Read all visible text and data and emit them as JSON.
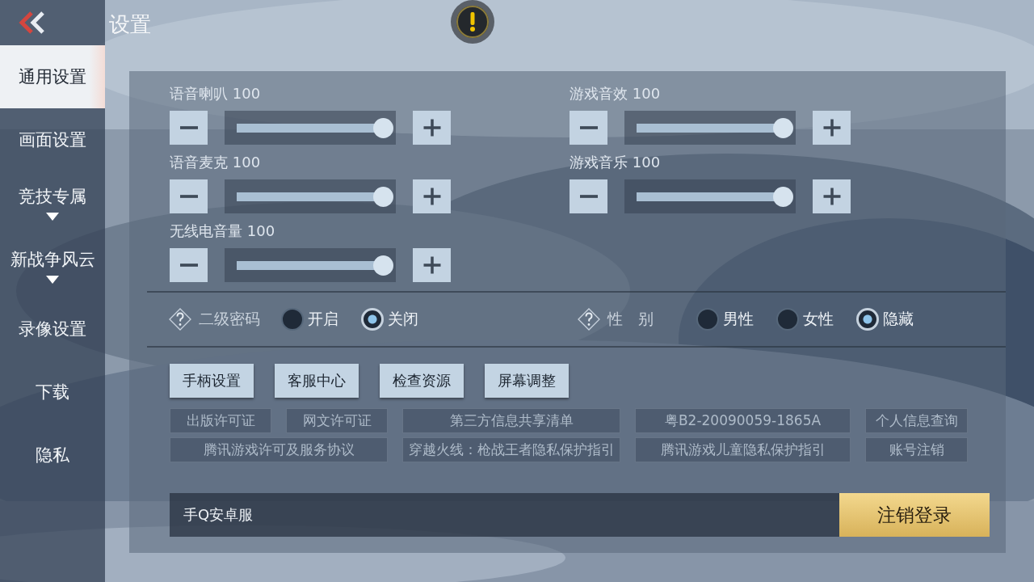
{
  "header": {
    "title": "设置"
  },
  "sidebar": {
    "items": [
      {
        "label": "通用设置",
        "selected": true,
        "has_submenu": false
      },
      {
        "label": "画面设置",
        "selected": false,
        "has_submenu": false
      },
      {
        "label": "竞技专属",
        "selected": false,
        "has_submenu": true
      },
      {
        "label": "新战争风云",
        "selected": false,
        "has_submenu": true
      },
      {
        "label": "录像设置",
        "selected": false,
        "has_submenu": false
      },
      {
        "label": "下载",
        "selected": false,
        "has_submenu": false
      },
      {
        "label": "隐私",
        "selected": false,
        "has_submenu": false
      }
    ]
  },
  "volume_columns": [
    [
      {
        "label": "语音喇叭",
        "reading": "100",
        "level": 1.0
      },
      {
        "label": "语音麦克",
        "reading": "100",
        "level": 1.0
      },
      {
        "label": "无线电音量",
        "reading": "100",
        "level": 1.0
      }
    ],
    [
      {
        "label": "游戏音效",
        "reading": "100",
        "level": 1.0
      },
      {
        "label": "游戏音乐",
        "reading": "100",
        "level": 1.0
      }
    ]
  ],
  "radio_groups": [
    {
      "label": "二级密码",
      "options": [
        {
          "label": "开启",
          "selected": false
        },
        {
          "label": "关闭",
          "selected": true
        }
      ]
    },
    {
      "label": "性　别",
      "options": [
        {
          "label": "男性",
          "selected": false
        },
        {
          "label": "女性",
          "selected": false
        },
        {
          "label": "隐藏",
          "selected": true
        }
      ]
    }
  ],
  "buttons": [
    "手柄设置",
    "客服中心",
    "检查资源",
    "屏幕调整"
  ],
  "link_rows": [
    [
      "出版许可证",
      "网文许可证",
      "第三方信息共享清单",
      "粤B2-20090059-1865A",
      "个人信息查询"
    ],
    [
      "腾讯游戏许可及服务协议",
      "穿越火线：枪战王者隐私保护指引",
      "腾讯游戏儿童隐私保护指引",
      "账号注销"
    ]
  ],
  "account": {
    "server": "手Q安卓服",
    "logout": "注销登录"
  }
}
